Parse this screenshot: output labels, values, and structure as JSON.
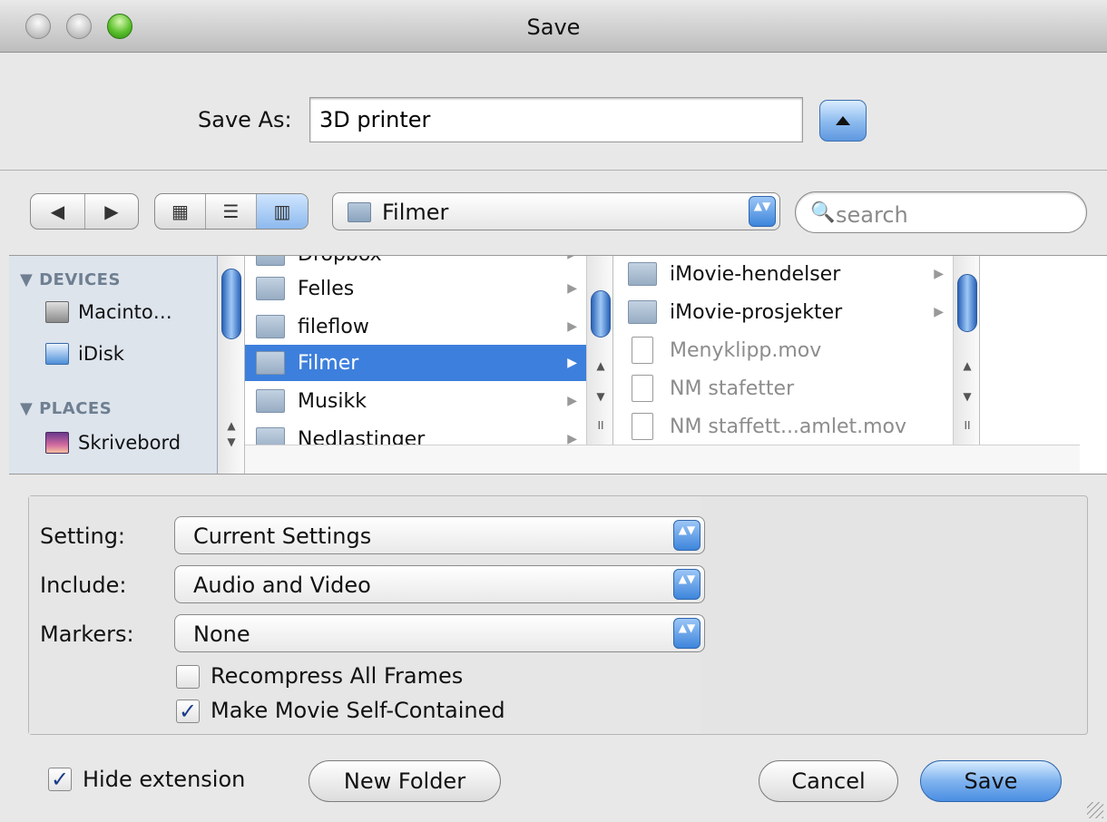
{
  "window": {
    "title": "Save"
  },
  "save_as": {
    "label": "Save As:",
    "value": "3D printer"
  },
  "toolbar": {
    "back_glyph": "◀",
    "forward_glyph": "▶",
    "view_icons_glyph": "▦",
    "view_list_glyph": "☰",
    "view_columns_glyph": "▥",
    "location": "Filmer",
    "search_placeholder": "search",
    "search_glyph": "🔍"
  },
  "sidebar": {
    "devices_header": "▼ DEVICES",
    "places_header": "▼ PLACES",
    "devices": [
      {
        "label": "Macinto…",
        "icon": "hard-drive-icon"
      },
      {
        "label": "iDisk",
        "icon": "idisk-icon"
      }
    ],
    "places": [
      {
        "label": "Skrivebord",
        "icon": "desktop-icon"
      }
    ]
  },
  "column1": {
    "items": [
      {
        "label": "Dropbox",
        "icon": "folder-icon"
      },
      {
        "label": "Felles",
        "icon": "shared-folder-icon"
      },
      {
        "label": "fileflow",
        "icon": "folder-icon"
      },
      {
        "label": "Filmer",
        "icon": "movies-folder-icon",
        "selected": true
      },
      {
        "label": "Musikk",
        "icon": "music-folder-icon"
      },
      {
        "label": "Nedlastinger",
        "icon": "downloads-folder-icon"
      }
    ]
  },
  "column2": {
    "items": [
      {
        "label": "iMovie-hendelser",
        "icon": "folder-icon",
        "kind": "folder"
      },
      {
        "label": "iMovie-prosjekter",
        "icon": "folder-icon",
        "kind": "folder"
      },
      {
        "label": "Menyklipp.mov",
        "icon": "movie-file-icon",
        "kind": "file"
      },
      {
        "label": "NM stafetter",
        "icon": "movie-file-icon",
        "kind": "file"
      },
      {
        "label": "NM staffett...amlet.mov",
        "icon": "movie-file-icon",
        "kind": "file"
      }
    ]
  },
  "options": {
    "setting_label": "Setting:",
    "setting_value": "Current Settings",
    "include_label": "Include:",
    "include_value": "Audio and Video",
    "markers_label": "Markers:",
    "markers_value": "None",
    "recompress_label": "Recompress All Frames",
    "recompress_checked": false,
    "self_contained_label": "Make Movie Self-Contained",
    "self_contained_checked": true
  },
  "footer": {
    "hide_extension_label": "Hide extension",
    "hide_extension_checked": true,
    "new_folder_label": "New Folder",
    "cancel_label": "Cancel",
    "save_label": "Save"
  },
  "glyphs": {
    "check": "✓",
    "triangle_right": "▶",
    "stepper": "▲▼",
    "scroll_up": "▲",
    "scroll_down": "▼",
    "pause": "II"
  },
  "colors": {
    "selection": "#3d7fdc",
    "default_button": "#4a8ee2",
    "sidebar_bg": "#dde4ec"
  }
}
